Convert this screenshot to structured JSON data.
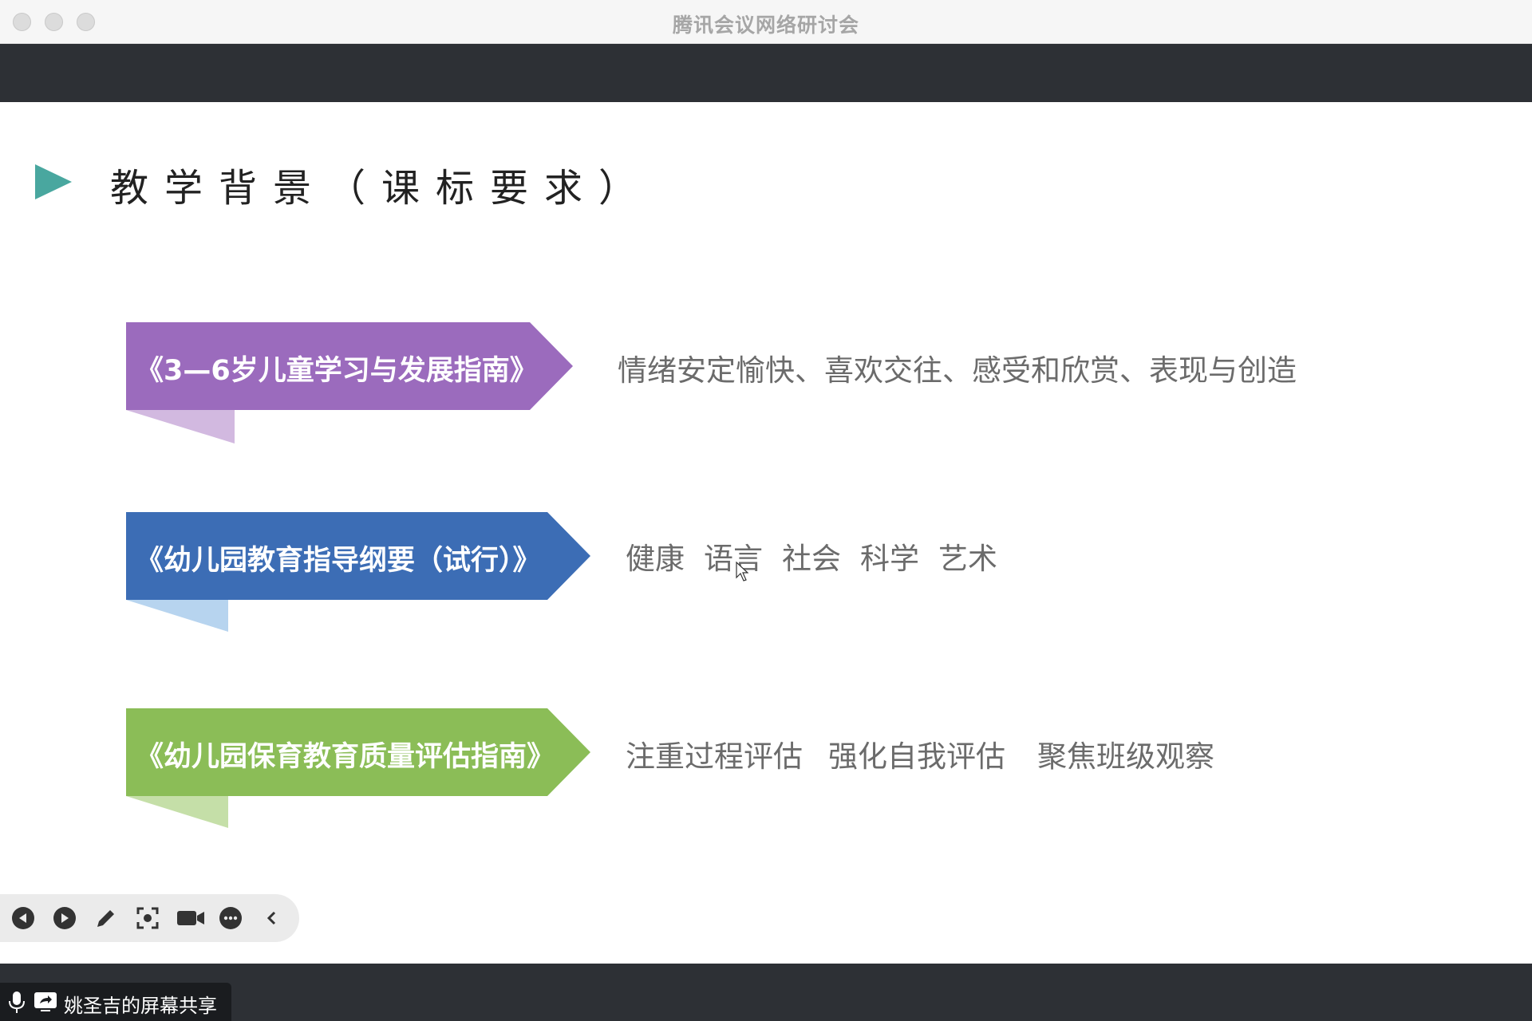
{
  "window": {
    "title": "腾讯会议网络研讨会"
  },
  "slide": {
    "title": "教学背景（课标要求）",
    "accent_color": "#49a79f",
    "rows": [
      {
        "banner": "《3—6岁儿童学习与发展指南》",
        "color": "#9b6bbd",
        "tail_color": "#d2b9e0",
        "items": [
          "情绪安定愉快、喜欢交往、感受和欣赏、表现与创造"
        ]
      },
      {
        "banner": "《幼儿园教育指导纲要（试行）》",
        "color": "#3c6db5",
        "tail_color": "#b7d4ef",
        "items": [
          "健康",
          "语言",
          "社会",
          "科学",
          "艺术"
        ]
      },
      {
        "banner": "《幼儿园保育教育质量评估指南》",
        "color": "#8bbd57",
        "tail_color": "#c5dfa8",
        "items": [
          "注重过程评估",
          "强化自我评估",
          "聚焦班级观察"
        ]
      }
    ]
  },
  "toolbar": {
    "buttons": [
      {
        "name": "previous-slide-button",
        "icon": "play-left-icon"
      },
      {
        "name": "next-slide-button",
        "icon": "play-right-icon"
      },
      {
        "name": "annotate-button",
        "icon": "pen-icon"
      },
      {
        "name": "laser-pointer-button",
        "icon": "focus-icon"
      },
      {
        "name": "camera-button",
        "icon": "video-camera-icon"
      },
      {
        "name": "more-button",
        "icon": "more-dots-icon"
      },
      {
        "name": "collapse-toolbar-button",
        "icon": "chevron-left-icon"
      }
    ]
  },
  "share": {
    "label": "姚圣吉的屏幕共享"
  }
}
